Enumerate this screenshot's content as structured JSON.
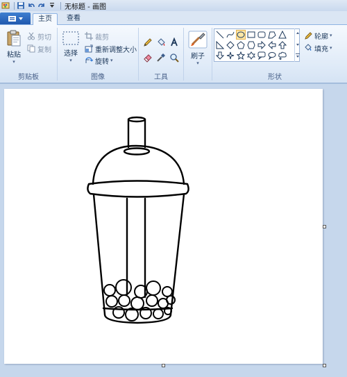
{
  "window": {
    "title": "无标题 - 画图"
  },
  "tabs": [
    {
      "label": "主页"
    },
    {
      "label": "查看"
    }
  ],
  "ribbon": {
    "clipboard": {
      "group_label": "剪贴板",
      "paste_label": "粘贴",
      "cut_label": "剪切",
      "copy_label": "复制"
    },
    "image": {
      "group_label": "图像",
      "select_label": "选择",
      "crop_label": "裁剪",
      "resize_label": "重新调整大小",
      "rotate_label": "旋转"
    },
    "tools": {
      "group_label": "工具"
    },
    "brushes": {
      "label": "刷子"
    },
    "shapes": {
      "group_label": "形状",
      "outline_label": "轮廓",
      "fill_label": "填充"
    }
  },
  "colors": {
    "accent": "#1f58ae",
    "ribbon_bg": "#e0ebf8",
    "workspace_bg": "#c6d7ec",
    "canvas_bg": "#ffffff"
  }
}
